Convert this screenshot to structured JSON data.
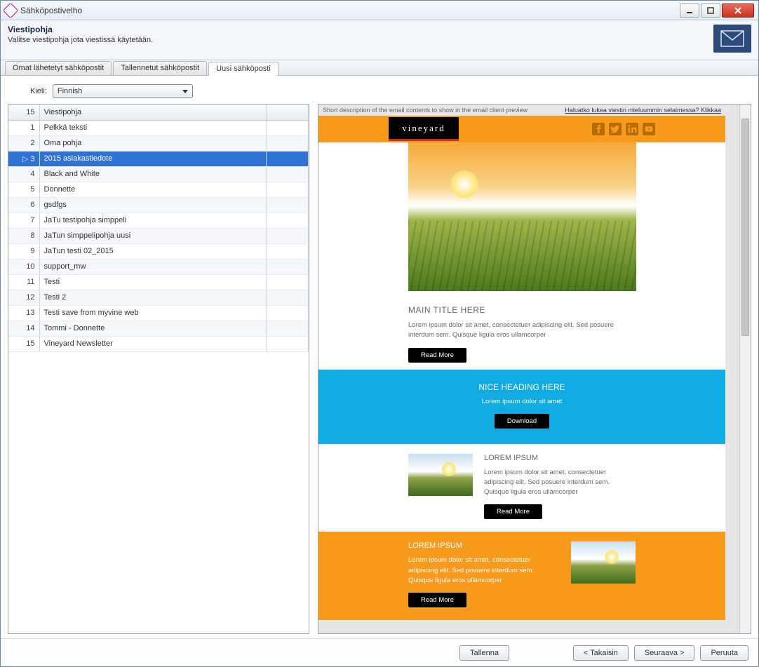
{
  "window": {
    "title": "Sähköpostivelho"
  },
  "header": {
    "title": "Viestipohja",
    "subtitle": "Valitse viestipohja jota viestissä käytetään."
  },
  "tabs": {
    "items": [
      {
        "label": "Omat lähetetyt sähköpostit",
        "active": false
      },
      {
        "label": "Tallennetut sähköpostit",
        "active": false
      },
      {
        "label": "Uusi sähköposti",
        "active": true
      }
    ]
  },
  "language": {
    "label": "Kieli:",
    "selected": "Finnish"
  },
  "grid": {
    "count_header": "15",
    "name_header": "Viestipohja",
    "selected_index": 2,
    "rows": [
      {
        "n": "1",
        "name": "Pelkkä teksti"
      },
      {
        "n": "2",
        "name": "Oma pohja"
      },
      {
        "n": "3",
        "name": "2015 asiakastiedote"
      },
      {
        "n": "4",
        "name": "Black and White"
      },
      {
        "n": "5",
        "name": "Donnette"
      },
      {
        "n": "6",
        "name": "gsdfgs"
      },
      {
        "n": "7",
        "name": "JaTu testipohja simppeli"
      },
      {
        "n": "8",
        "name": "JaTun simppelipohja uusi"
      },
      {
        "n": "9",
        "name": "JaTun testi 02_2015"
      },
      {
        "n": "10",
        "name": "support_mw"
      },
      {
        "n": "11",
        "name": "Testi"
      },
      {
        "n": "12",
        "name": "Testi 2"
      },
      {
        "n": "13",
        "name": "Testi save from myvine web"
      },
      {
        "n": "14",
        "name": "Tommi - Donnette"
      },
      {
        "n": "15",
        "name": "Vineyard Newsletter"
      }
    ]
  },
  "preview": {
    "top": {
      "desc": "Short description of the email contents to show in the email client preview",
      "link": "Haluatko lukea viestin mieluummin selaimessa? Klikkaa"
    },
    "logo": "vineyard",
    "main": {
      "title": "MAIN TITLE HERE",
      "body": "Lorem ipsum dolor sit amet, consectetuer adipiscing elit. Sed posuere interdum sem. Quisque ligula eros ullamcorper",
      "button": "Read More"
    },
    "cta": {
      "title": "NICE HEADING HERE",
      "body": "Lorem ipsum dolor sit amet",
      "button": "Download"
    },
    "block1": {
      "title": "LOREM IPSUM",
      "body": "Lorem ipsum dolor sit amet, consectetuer adipiscing elit. Sed posuere interdum sem. Quisque ligula eros ullamcorper",
      "button": "Read More"
    },
    "block2": {
      "title": "LOREM IPSUM",
      "body": "Lorem ipsum dolor sit amet, consectetuer adipiscing elit. Sed posuere interdum sem. Quisque ligula eros ullamcorper",
      "button": "Read More"
    }
  },
  "footer": {
    "save": "Tallenna",
    "back": "< Takaisin",
    "next": "Seuraava >",
    "cancel": "Peruuta"
  }
}
